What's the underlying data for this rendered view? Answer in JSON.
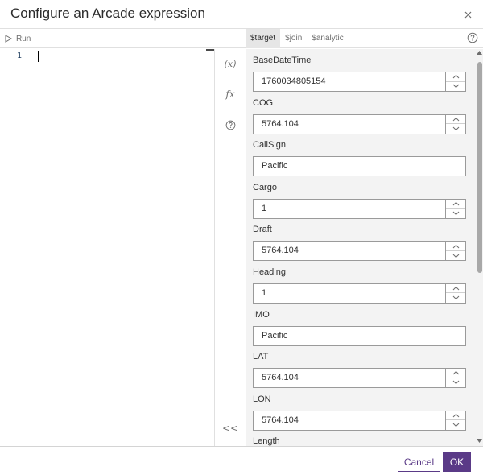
{
  "dialog": {
    "title": "Configure an Arcade expression"
  },
  "toolbar": {
    "run_label": "Run",
    "tabs": [
      {
        "label": "$target",
        "active": true
      },
      {
        "label": "$join",
        "active": false
      },
      {
        "label": "$analytic",
        "active": false
      }
    ]
  },
  "editor": {
    "line_number": "1"
  },
  "rail": {
    "variables_label": "(x)",
    "functions_label": "fx",
    "collapse_label": "<<"
  },
  "fields": [
    {
      "label": "BaseDateTime",
      "value": "1760034805154",
      "type": "number"
    },
    {
      "label": "COG",
      "value": "5764.104",
      "type": "number"
    },
    {
      "label": "CallSign",
      "value": "Pacific",
      "type": "text"
    },
    {
      "label": "Cargo",
      "value": "1",
      "type": "number"
    },
    {
      "label": "Draft",
      "value": "5764.104",
      "type": "number"
    },
    {
      "label": "Heading",
      "value": "1",
      "type": "number"
    },
    {
      "label": "IMO",
      "value": "Pacific",
      "type": "text"
    },
    {
      "label": "LAT",
      "value": "5764.104",
      "type": "number"
    },
    {
      "label": "LON",
      "value": "5764.104",
      "type": "number"
    },
    {
      "label": "Length",
      "value": "",
      "type": "number"
    }
  ],
  "footer": {
    "cancel_label": "Cancel",
    "ok_label": "OK"
  },
  "colors": {
    "accent": "#5a3a87",
    "panel_bg": "#f3f3f3",
    "active_tab_bg": "#e6e6e6"
  }
}
